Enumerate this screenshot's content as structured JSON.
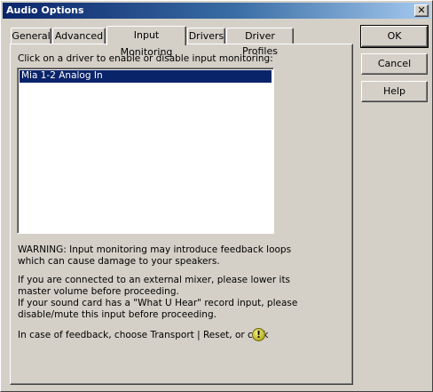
{
  "window": {
    "title": "Audio Options",
    "close_glyph": "✕"
  },
  "tabs": [
    {
      "label": "General",
      "active": false
    },
    {
      "label": "Advanced",
      "active": false
    },
    {
      "label": "Input Monitoring",
      "active": true
    },
    {
      "label": "Drivers",
      "active": false
    },
    {
      "label": "Driver Profiles",
      "active": false
    }
  ],
  "buttons": {
    "ok": "OK",
    "cancel": "Cancel",
    "help": "Help"
  },
  "panel": {
    "instruction": "Click on a driver to enable or disable input monitoring:",
    "drivers": [
      {
        "name": "Mia 1-2 Analog In",
        "selected": true
      }
    ],
    "warning": "WARNING: Input monitoring may introduce feedback loops\nwhich can cause damage to your speakers.",
    "mixer_note": "If you are connected to an external mixer, please lower its\nmaster volume before proceeding.\nIf your sound card has a \"What U Hear\" record input, please\ndisable/mute this input before proceeding.",
    "feedback_note": "In case of feedback, choose Transport | Reset, or click",
    "reset_icon": "reset-exclamation-icon",
    "reset_glyph": "!"
  },
  "colors": {
    "face": "#d4d0c8",
    "title_start": "#0a246a",
    "title_end": "#a6caf0",
    "selection": "#0a246a",
    "reset_icon": "#e0d94a"
  }
}
